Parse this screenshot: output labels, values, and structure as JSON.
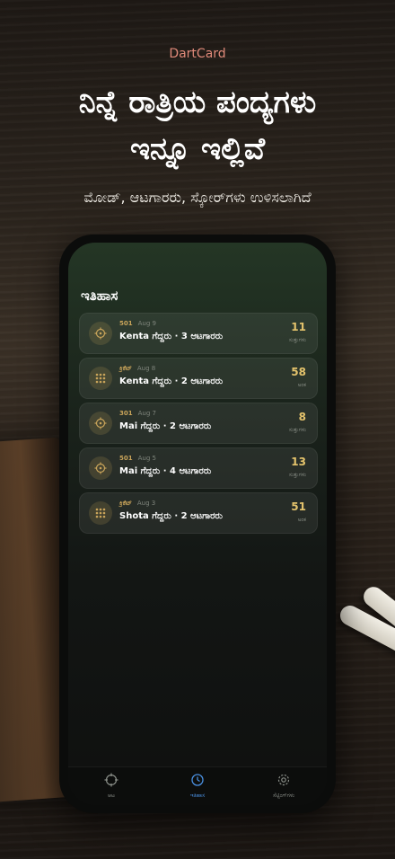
{
  "brand": "DartCard",
  "headline_line1": "ನಿನ್ನೆ ರಾತ್ರಿಯ ಪಂದ್ಯಗಳು",
  "headline_line2": "ಇನ್ನೂ ಇಲ್ಲಿವೆ",
  "subheadline": "ಮೋಡ್, ಆಟಗಾರರು, ಸ್ಕೋರ್‌ಗಳು ಉಳಿಸಲಾಗಿದೆ",
  "screen": {
    "title": "ಇತಿಹಾಸ",
    "games": [
      {
        "mode": "501",
        "date": "Aug 9",
        "summary": "Kenta ಗೆದ್ದರು · 3 ಆಟಗಾರರು",
        "score": "11",
        "unit": "ಸುತ್ತುಗಳು",
        "icon": "target-icon"
      },
      {
        "mode": "ಕ್ರಿಕೆಟ್",
        "date": "Aug 8",
        "summary": "Kenta ಗೆದ್ದರು · 2 ಆಟಗಾರರು",
        "score": "58",
        "unit": "ಅಂಕ",
        "icon": "grid-icon"
      },
      {
        "mode": "301",
        "date": "Aug 7",
        "summary": "Mai ಗೆದ್ದರು · 2 ಆಟಗಾರರು",
        "score": "8",
        "unit": "ಸುತ್ತುಗಳು",
        "icon": "target-icon"
      },
      {
        "mode": "501",
        "date": "Aug 5",
        "summary": "Mai ಗೆದ್ದರು · 4 ಆಟಗಾರರು",
        "score": "13",
        "unit": "ಸುತ್ತುಗಳು",
        "icon": "target-icon"
      },
      {
        "mode": "ಕ್ರಿಕೆಟ್",
        "date": "Aug 3",
        "summary": "Shota ಗೆದ್ದರು · 2 ಆಟಗಾರರು",
        "score": "51",
        "unit": "ಅಂಕ",
        "icon": "grid-icon"
      }
    ],
    "tabs": [
      {
        "label": "ಆಟ",
        "icon": "crosshair-icon",
        "active": false
      },
      {
        "label": "ಇತಿಹಾಸ",
        "icon": "clock-icon",
        "active": true
      },
      {
        "label": "ಸೆಟ್ಟಿಂಗ್‌ಗಳು",
        "icon": "gear-icon",
        "active": false
      }
    ]
  },
  "colors": {
    "accent_gold": "#c9a45a",
    "score_gold": "#e4c36c",
    "active_tab_blue": "#4a90e2",
    "brand_pink": "#e08a7a"
  }
}
